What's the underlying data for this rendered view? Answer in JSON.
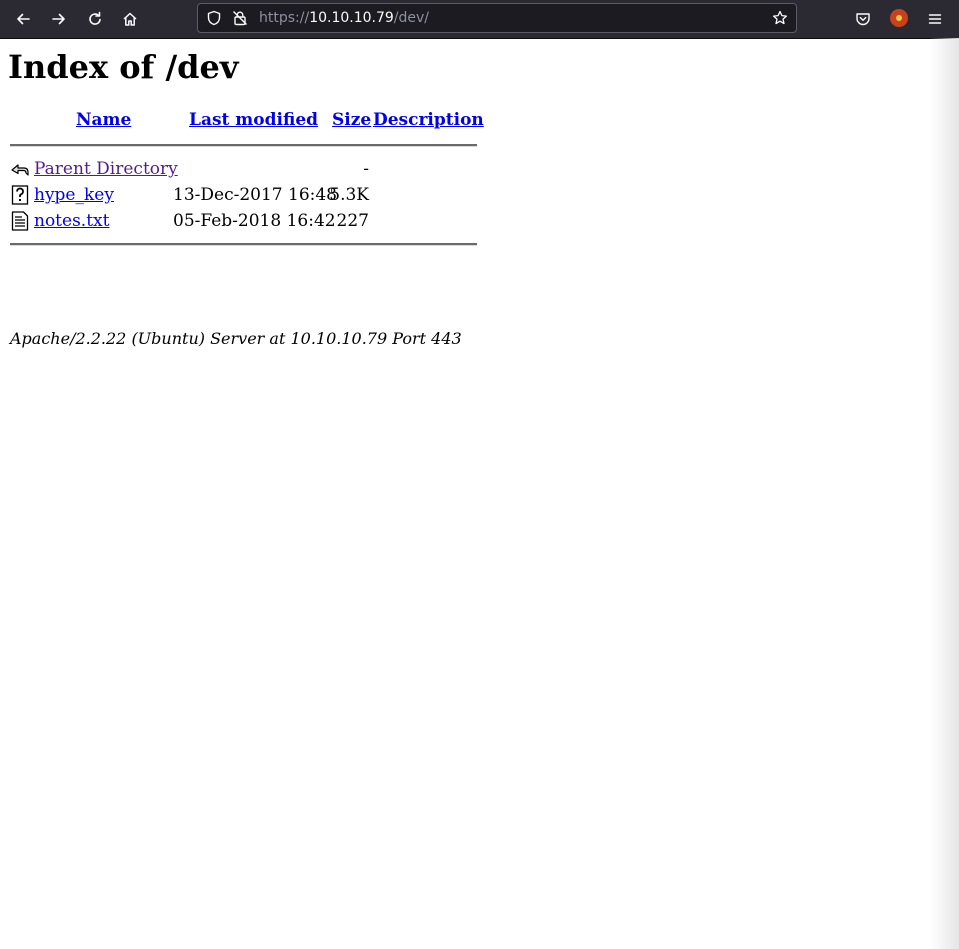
{
  "browser": {
    "url_scheme": "https://",
    "url_host": "10.10.10.79",
    "url_path": "/dev/",
    "colors": {
      "toolbar_bg": "#2b2a33",
      "urlbar_bg": "#1c1b22"
    }
  },
  "page": {
    "title": "Index of /dev",
    "columns": {
      "name": "Name",
      "last_modified": "Last modified",
      "size": "Size",
      "description": "Description"
    },
    "entries": [
      {
        "icon": "back-icon",
        "name": "Parent Directory",
        "modified": "",
        "size": "-"
      },
      {
        "icon": "unknown-file-icon",
        "name": "hype_key",
        "modified": "13-Dec-2017 16:48",
        "size": "5.3K"
      },
      {
        "icon": "text-file-icon",
        "name": "notes.txt",
        "modified": "05-Feb-2018 16:42",
        "size": "227"
      }
    ],
    "footer": "Apache/2.2.22 (Ubuntu) Server at 10.10.10.79 Port 443",
    "colors": {
      "link": "#0000ee",
      "visited": "#551a8b"
    }
  }
}
